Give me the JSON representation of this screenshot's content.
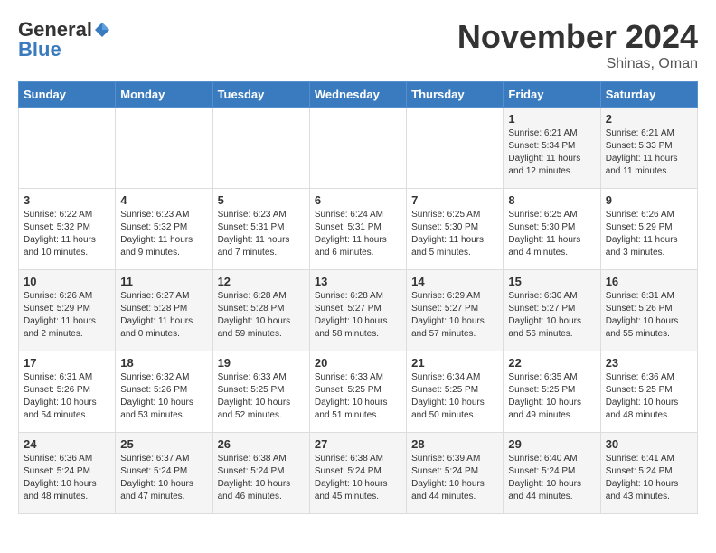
{
  "header": {
    "logo_general": "General",
    "logo_blue": "Blue",
    "month": "November 2024",
    "location": "Shinas, Oman"
  },
  "weekdays": [
    "Sunday",
    "Monday",
    "Tuesday",
    "Wednesday",
    "Thursday",
    "Friday",
    "Saturday"
  ],
  "weeks": [
    [
      {
        "day": "",
        "info": ""
      },
      {
        "day": "",
        "info": ""
      },
      {
        "day": "",
        "info": ""
      },
      {
        "day": "",
        "info": ""
      },
      {
        "day": "",
        "info": ""
      },
      {
        "day": "1",
        "info": "Sunrise: 6:21 AM\nSunset: 5:34 PM\nDaylight: 11 hours and 12 minutes."
      },
      {
        "day": "2",
        "info": "Sunrise: 6:21 AM\nSunset: 5:33 PM\nDaylight: 11 hours and 11 minutes."
      }
    ],
    [
      {
        "day": "3",
        "info": "Sunrise: 6:22 AM\nSunset: 5:32 PM\nDaylight: 11 hours and 10 minutes."
      },
      {
        "day": "4",
        "info": "Sunrise: 6:23 AM\nSunset: 5:32 PM\nDaylight: 11 hours and 9 minutes."
      },
      {
        "day": "5",
        "info": "Sunrise: 6:23 AM\nSunset: 5:31 PM\nDaylight: 11 hours and 7 minutes."
      },
      {
        "day": "6",
        "info": "Sunrise: 6:24 AM\nSunset: 5:31 PM\nDaylight: 11 hours and 6 minutes."
      },
      {
        "day": "7",
        "info": "Sunrise: 6:25 AM\nSunset: 5:30 PM\nDaylight: 11 hours and 5 minutes."
      },
      {
        "day": "8",
        "info": "Sunrise: 6:25 AM\nSunset: 5:30 PM\nDaylight: 11 hours and 4 minutes."
      },
      {
        "day": "9",
        "info": "Sunrise: 6:26 AM\nSunset: 5:29 PM\nDaylight: 11 hours and 3 minutes."
      }
    ],
    [
      {
        "day": "10",
        "info": "Sunrise: 6:26 AM\nSunset: 5:29 PM\nDaylight: 11 hours and 2 minutes."
      },
      {
        "day": "11",
        "info": "Sunrise: 6:27 AM\nSunset: 5:28 PM\nDaylight: 11 hours and 0 minutes."
      },
      {
        "day": "12",
        "info": "Sunrise: 6:28 AM\nSunset: 5:28 PM\nDaylight: 10 hours and 59 minutes."
      },
      {
        "day": "13",
        "info": "Sunrise: 6:28 AM\nSunset: 5:27 PM\nDaylight: 10 hours and 58 minutes."
      },
      {
        "day": "14",
        "info": "Sunrise: 6:29 AM\nSunset: 5:27 PM\nDaylight: 10 hours and 57 minutes."
      },
      {
        "day": "15",
        "info": "Sunrise: 6:30 AM\nSunset: 5:27 PM\nDaylight: 10 hours and 56 minutes."
      },
      {
        "day": "16",
        "info": "Sunrise: 6:31 AM\nSunset: 5:26 PM\nDaylight: 10 hours and 55 minutes."
      }
    ],
    [
      {
        "day": "17",
        "info": "Sunrise: 6:31 AM\nSunset: 5:26 PM\nDaylight: 10 hours and 54 minutes."
      },
      {
        "day": "18",
        "info": "Sunrise: 6:32 AM\nSunset: 5:26 PM\nDaylight: 10 hours and 53 minutes."
      },
      {
        "day": "19",
        "info": "Sunrise: 6:33 AM\nSunset: 5:25 PM\nDaylight: 10 hours and 52 minutes."
      },
      {
        "day": "20",
        "info": "Sunrise: 6:33 AM\nSunset: 5:25 PM\nDaylight: 10 hours and 51 minutes."
      },
      {
        "day": "21",
        "info": "Sunrise: 6:34 AM\nSunset: 5:25 PM\nDaylight: 10 hours and 50 minutes."
      },
      {
        "day": "22",
        "info": "Sunrise: 6:35 AM\nSunset: 5:25 PM\nDaylight: 10 hours and 49 minutes."
      },
      {
        "day": "23",
        "info": "Sunrise: 6:36 AM\nSunset: 5:25 PM\nDaylight: 10 hours and 48 minutes."
      }
    ],
    [
      {
        "day": "24",
        "info": "Sunrise: 6:36 AM\nSunset: 5:24 PM\nDaylight: 10 hours and 48 minutes."
      },
      {
        "day": "25",
        "info": "Sunrise: 6:37 AM\nSunset: 5:24 PM\nDaylight: 10 hours and 47 minutes."
      },
      {
        "day": "26",
        "info": "Sunrise: 6:38 AM\nSunset: 5:24 PM\nDaylight: 10 hours and 46 minutes."
      },
      {
        "day": "27",
        "info": "Sunrise: 6:38 AM\nSunset: 5:24 PM\nDaylight: 10 hours and 45 minutes."
      },
      {
        "day": "28",
        "info": "Sunrise: 6:39 AM\nSunset: 5:24 PM\nDaylight: 10 hours and 44 minutes."
      },
      {
        "day": "29",
        "info": "Sunrise: 6:40 AM\nSunset: 5:24 PM\nDaylight: 10 hours and 44 minutes."
      },
      {
        "day": "30",
        "info": "Sunrise: 6:41 AM\nSunset: 5:24 PM\nDaylight: 10 hours and 43 minutes."
      }
    ]
  ]
}
